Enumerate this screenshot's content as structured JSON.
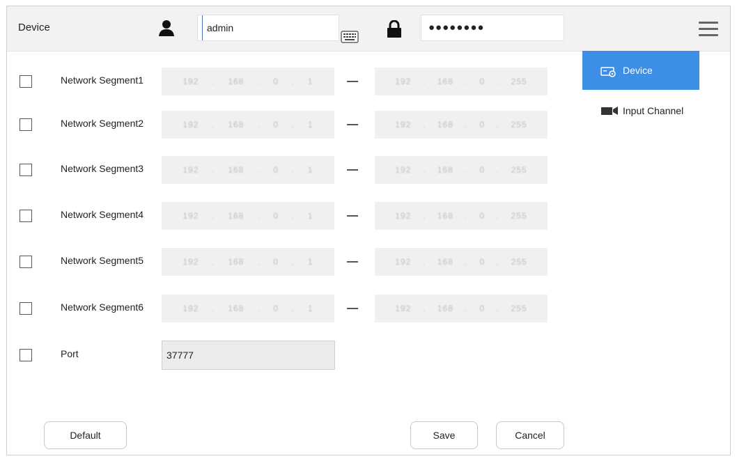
{
  "header": {
    "title": "Device",
    "username": "admin",
    "password_masked": "●●●●●●●●"
  },
  "segments": [
    {
      "label": "Network Segment1",
      "start": [
        "192",
        "168",
        "0",
        "1"
      ],
      "end": [
        "192",
        "168",
        "0",
        "255"
      ]
    },
    {
      "label": "Network Segment2",
      "start": [
        "192",
        "168",
        "0",
        "1"
      ],
      "end": [
        "192",
        "168",
        "0",
        "255"
      ]
    },
    {
      "label": "Network Segment3",
      "start": [
        "192",
        "168",
        "0",
        "1"
      ],
      "end": [
        "192",
        "168",
        "0",
        "255"
      ]
    },
    {
      "label": "Network Segment4",
      "start": [
        "192",
        "168",
        "0",
        "1"
      ],
      "end": [
        "192",
        "168",
        "0",
        "255"
      ]
    },
    {
      "label": "Network Segment5",
      "start": [
        "192",
        "168",
        "0",
        "1"
      ],
      "end": [
        "192",
        "168",
        "0",
        "255"
      ]
    },
    {
      "label": "Network Segment6",
      "start": [
        "192",
        "168",
        "0",
        "1"
      ],
      "end": [
        "192",
        "168",
        "0",
        "255"
      ]
    }
  ],
  "port": {
    "label": "Port",
    "value": "37777"
  },
  "sidebar": {
    "items": [
      {
        "label": "Device",
        "active": true
      },
      {
        "label": "Input Channel",
        "active": false
      }
    ]
  },
  "buttons": {
    "default_label": "Default",
    "save_label": "Save",
    "cancel_label": "Cancel"
  },
  "colors": {
    "accent": "#3d8ee6",
    "header_bg": "#f2f2f2",
    "field_bg": "#f0f0f0"
  }
}
